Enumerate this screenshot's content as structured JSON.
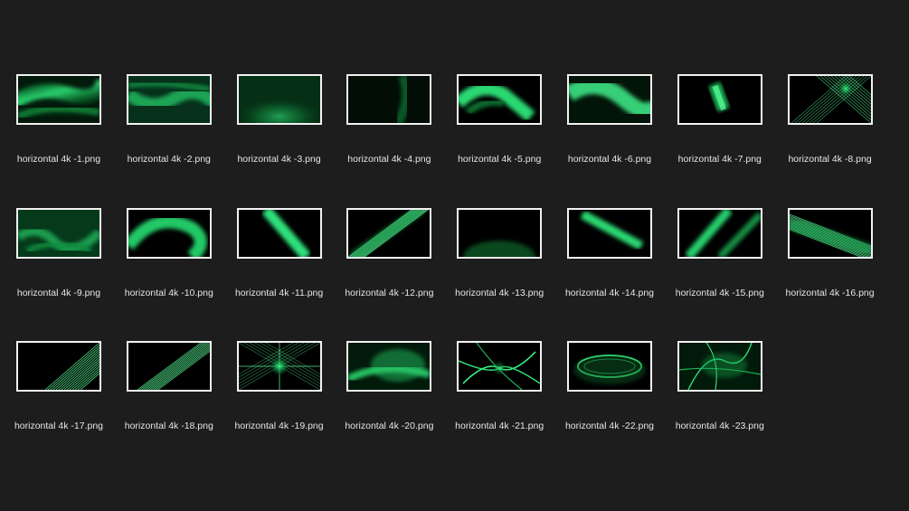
{
  "files": [
    {
      "name": "horizontal 4k -1.png",
      "style": "swoosh-left"
    },
    {
      "name": "horizontal 4k -2.png",
      "style": "wave"
    },
    {
      "name": "horizontal 4k -3.png",
      "style": "glow-bottom"
    },
    {
      "name": "horizontal 4k -4.png",
      "style": "dim-streak"
    },
    {
      "name": "horizontal 4k -5.png",
      "style": "fold"
    },
    {
      "name": "horizontal 4k -6.png",
      "style": "bright-wave"
    },
    {
      "name": "horizontal 4k -7.png",
      "style": "prism"
    },
    {
      "name": "horizontal 4k -8.png",
      "style": "starburst-lines"
    },
    {
      "name": "horizontal 4k -9.png",
      "style": "smoke"
    },
    {
      "name": "horizontal 4k -10.png",
      "style": "arc"
    },
    {
      "name": "horizontal 4k -11.png",
      "style": "diag-beam"
    },
    {
      "name": "horizontal 4k -12.png",
      "style": "striped-beam"
    },
    {
      "name": "horizontal 4k -13.png",
      "style": "faint-glow"
    },
    {
      "name": "horizontal 4k -14.png",
      "style": "beam-right"
    },
    {
      "name": "horizontal 4k -15.png",
      "style": "double-beam"
    },
    {
      "name": "horizontal 4k -16.png",
      "style": "striped-fan"
    },
    {
      "name": "horizontal 4k -17.png",
      "style": "curve-stripes"
    },
    {
      "name": "horizontal 4k -18.png",
      "style": "striped-diag"
    },
    {
      "name": "horizontal 4k -19.png",
      "style": "burst"
    },
    {
      "name": "horizontal 4k -20.png",
      "style": "cloud"
    },
    {
      "name": "horizontal 4k -21.png",
      "style": "tendrils"
    },
    {
      "name": "horizontal 4k -22.png",
      "style": "ring"
    },
    {
      "name": "horizontal 4k -23.png",
      "style": "fibers"
    }
  ],
  "colors": {
    "background": "#1e1d1e",
    "accent": "#1fd36a",
    "frame": "#f2f2f2",
    "label": "#e6e6e6"
  }
}
